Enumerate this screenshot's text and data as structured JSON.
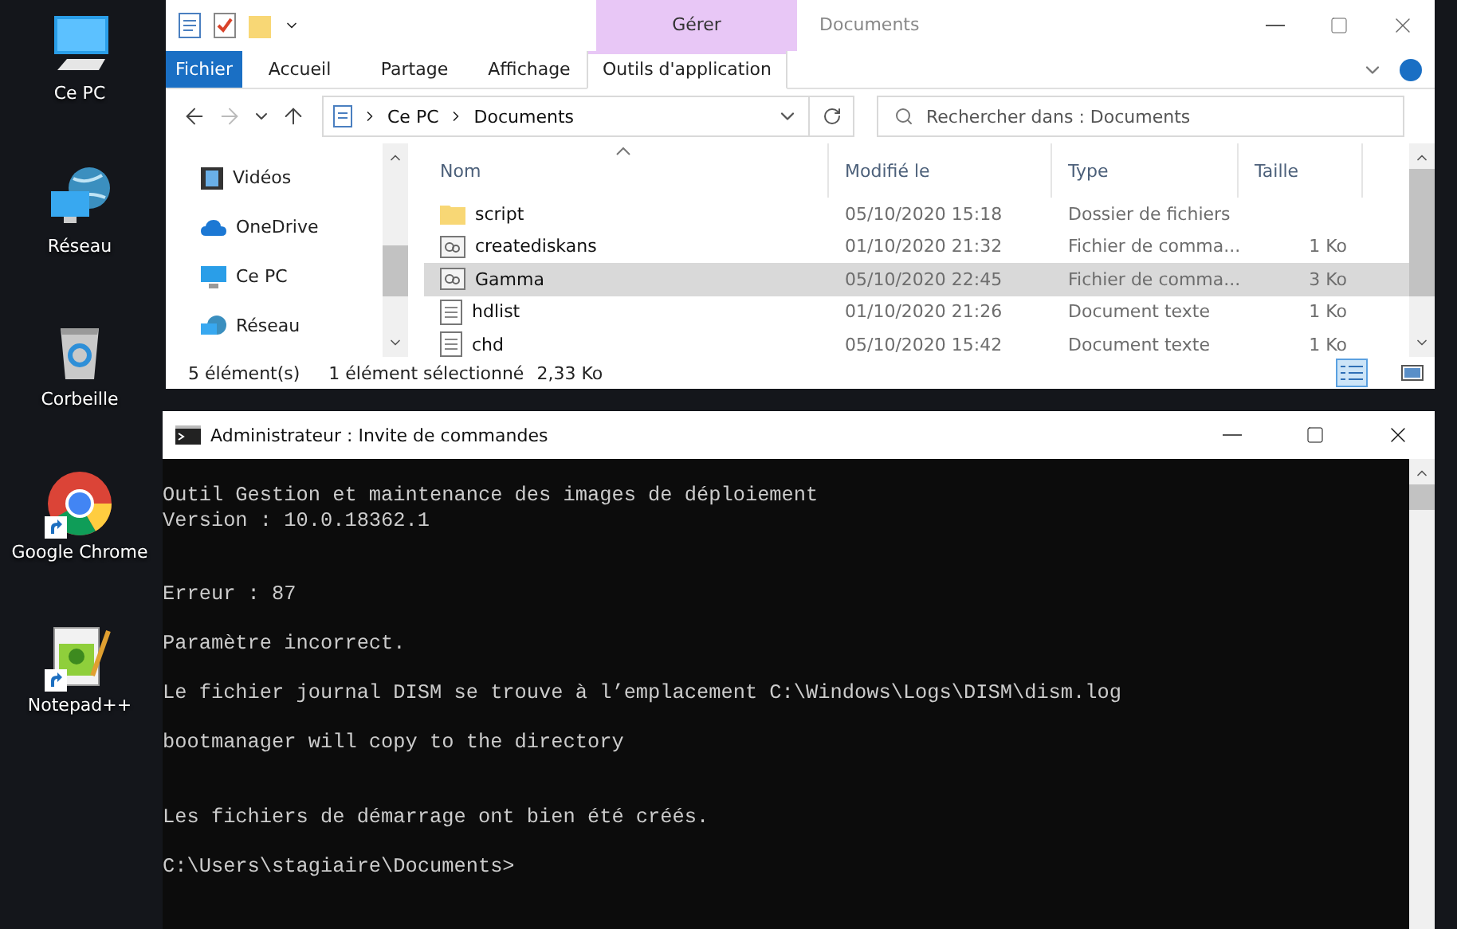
{
  "desktop": {
    "icons": [
      {
        "label": "Ce PC",
        "kind": "computer",
        "shortcut": false
      },
      {
        "label": "Réseau",
        "kind": "network",
        "shortcut": false
      },
      {
        "label": "Corbeille",
        "kind": "bin",
        "shortcut": false
      },
      {
        "label": "Google Chrome",
        "kind": "browser",
        "shortcut": true
      },
      {
        "label": "Notepad++",
        "kind": "notepad",
        "shortcut": true
      }
    ]
  },
  "explorer": {
    "title": "Documents",
    "context_tab": "Gérer",
    "ribbon_tabs": [
      {
        "label": "Fichier",
        "kind": "file",
        "selected": false
      },
      {
        "label": "Accueil",
        "kind": "tab",
        "selected": false
      },
      {
        "label": "Partage",
        "kind": "tab",
        "selected": false
      },
      {
        "label": "Affichage",
        "kind": "tab",
        "selected": false
      },
      {
        "label": "Outils d'application",
        "kind": "context",
        "selected": true
      }
    ],
    "address": [
      "Ce PC",
      "Documents"
    ],
    "search": {
      "placeholder": "Rechercher dans : Documents"
    },
    "nav_items": [
      {
        "label": "Vidéos",
        "kind": "videos"
      },
      {
        "label": "OneDrive",
        "kind": "cloud"
      },
      {
        "label": "Ce PC",
        "kind": "computer"
      },
      {
        "label": "Réseau",
        "kind": "network"
      }
    ],
    "columns": [
      "Nom",
      "Modifié le",
      "Type",
      "Taille"
    ],
    "files": [
      {
        "name": "script",
        "modified": "05/10/2020 15:18",
        "type": "Dossier de fichiers",
        "kind": "folder",
        "selected": false
      },
      {
        "name": "creatediskans",
        "modified": "01/10/2020 21:32",
        "type": "Fichier de comma...",
        "size": "1 Ko",
        "kind": "script",
        "selected": false
      },
      {
        "name": "Gamma",
        "modified": "05/10/2020 22:45",
        "type": "Fichier de comma...",
        "size": "3 Ko",
        "kind": "script",
        "selected": true
      },
      {
        "name": "hdlist",
        "modified": "01/10/2020 21:26",
        "type": "Document texte",
        "size": "1 Ko",
        "kind": "text",
        "selected": false
      },
      {
        "name": "chd",
        "modified": "05/10/2020 15:42",
        "type": "Document texte",
        "size": "1 Ko",
        "kind": "text",
        "selected": false
      }
    ],
    "status": {
      "count": "5 élément(s)",
      "selection": "1 élément sélectionné",
      "selection_size": "2,33 Ko"
    }
  },
  "console": {
    "title": "Administrateur : Invite de commandes",
    "blocks": [
      {
        "kind": "normal",
        "lines": [
          "Outil Gestion et maintenance des images de déploiement",
          "Version : 10.0.18362.1"
        ]
      },
      {
        "kind": "spaced",
        "lines": [
          "Erreur : 87"
        ]
      },
      {
        "kind": "normal",
        "lines": [
          "Paramètre incorrect."
        ]
      },
      {
        "kind": "normal",
        "lines": [
          "Le fichier journal DISM se trouve à l’emplacement C:\\Windows\\Logs\\DISM\\dism.log"
        ]
      },
      {
        "kind": "normal",
        "lines": [
          "bootmanager will copy to the directory"
        ]
      },
      {
        "kind": "spaced",
        "lines": [
          "Les fichiers de démarrage ont bien été créés."
        ]
      },
      {
        "kind": "normal",
        "lines": [
          "C:\\Users\\stagiaire\\Documents>"
        ]
      }
    ]
  }
}
